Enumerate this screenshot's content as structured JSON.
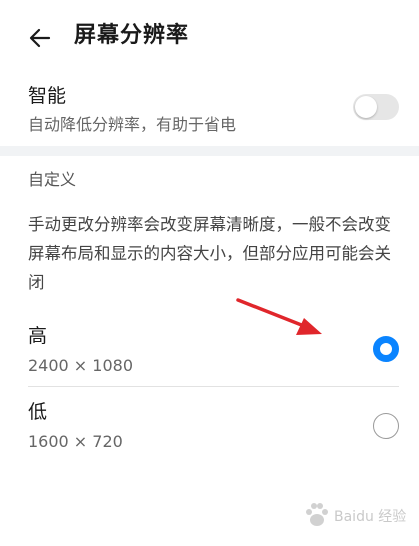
{
  "header": {
    "title": "屏幕分辨率",
    "back_icon": "arrow-left-icon"
  },
  "smart": {
    "title": "智能",
    "subtitle": "自动降低分辨率，有助于省电",
    "toggle_on": false
  },
  "custom": {
    "section_title": "自定义",
    "description": "手动更改分辨率会改变屏幕清晰度，一般不会改变屏幕布局和显示的内容大小，但部分应用可能会关闭"
  },
  "options": [
    {
      "label": "高",
      "value": "2400 × 1080",
      "selected": true
    },
    {
      "label": "低",
      "value": "1600 × 720",
      "selected": false
    }
  ],
  "colors": {
    "accent": "#0a84ff",
    "annotation_arrow": "#e0262b"
  },
  "watermark": {
    "text": "Baidu 经验"
  }
}
